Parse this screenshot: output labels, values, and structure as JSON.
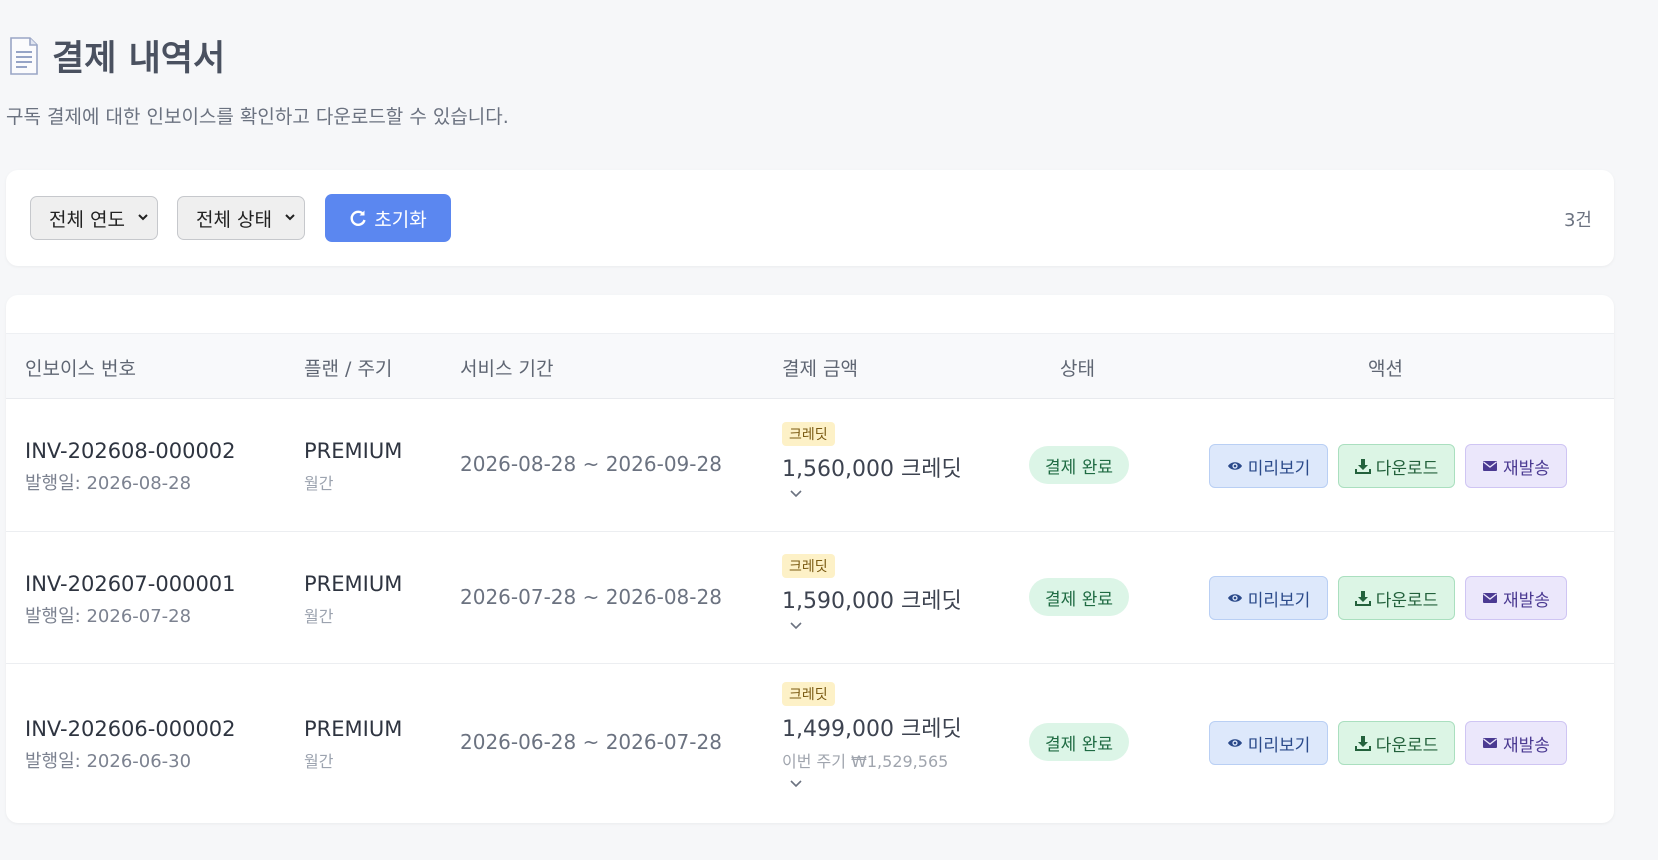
{
  "page": {
    "title": "결제 내역서",
    "subtitle": "구독 결제에 대한 인보이스를 확인하고 다운로드할 수 있습니다."
  },
  "filters": {
    "year_select": "전체 연도",
    "status_select": "전체 상태",
    "reset_label": "초기화",
    "count": "3건"
  },
  "table": {
    "columns": [
      "인보이스 번호",
      "플랜 / 주기",
      "서비스 기간",
      "결제 금액",
      "상태",
      "액션"
    ],
    "rows": [
      {
        "invoice_no": "INV-202608-000002",
        "issued": "발행일: 2026-08-28",
        "plan": "PREMIUM",
        "cycle": "월간",
        "period": "2026-08-28 ~ 2026-09-28",
        "badge": "크레딧",
        "amount": "1,560,000 크레딧",
        "note": "",
        "status": "결제 완료"
      },
      {
        "invoice_no": "INV-202607-000001",
        "issued": "발행일: 2026-07-28",
        "plan": "PREMIUM",
        "cycle": "월간",
        "period": "2026-07-28 ~ 2026-08-28",
        "badge": "크레딧",
        "amount": "1,590,000 크레딧",
        "note": "",
        "status": "결제 완료"
      },
      {
        "invoice_no": "INV-202606-000002",
        "issued": "발행일: 2026-06-30",
        "plan": "PREMIUM",
        "cycle": "월간",
        "period": "2026-06-28 ~ 2026-07-28",
        "badge": "크레딧",
        "amount": "1,499,000 크레딧",
        "note": "이번 주기 ₩1,529,565",
        "status": "결제 완료"
      }
    ],
    "actions": {
      "preview": "미리보기",
      "download": "다운로드",
      "resend": "재발송"
    }
  },
  "icons": {
    "title": "document-icon",
    "reset": "refresh-icon",
    "preview": "eye-icon",
    "download": "download-icon",
    "resend": "envelope-icon",
    "expand": "chevron-down-icon"
  },
  "colors": {
    "primary": "#5b87f0",
    "paid_badge_bg": "#dcf5e7",
    "credit_badge_bg": "#fdf1c7",
    "preview_bg": "#dde8fb",
    "download_bg": "#dcf5e5",
    "resend_bg": "#ebe7fb"
  }
}
